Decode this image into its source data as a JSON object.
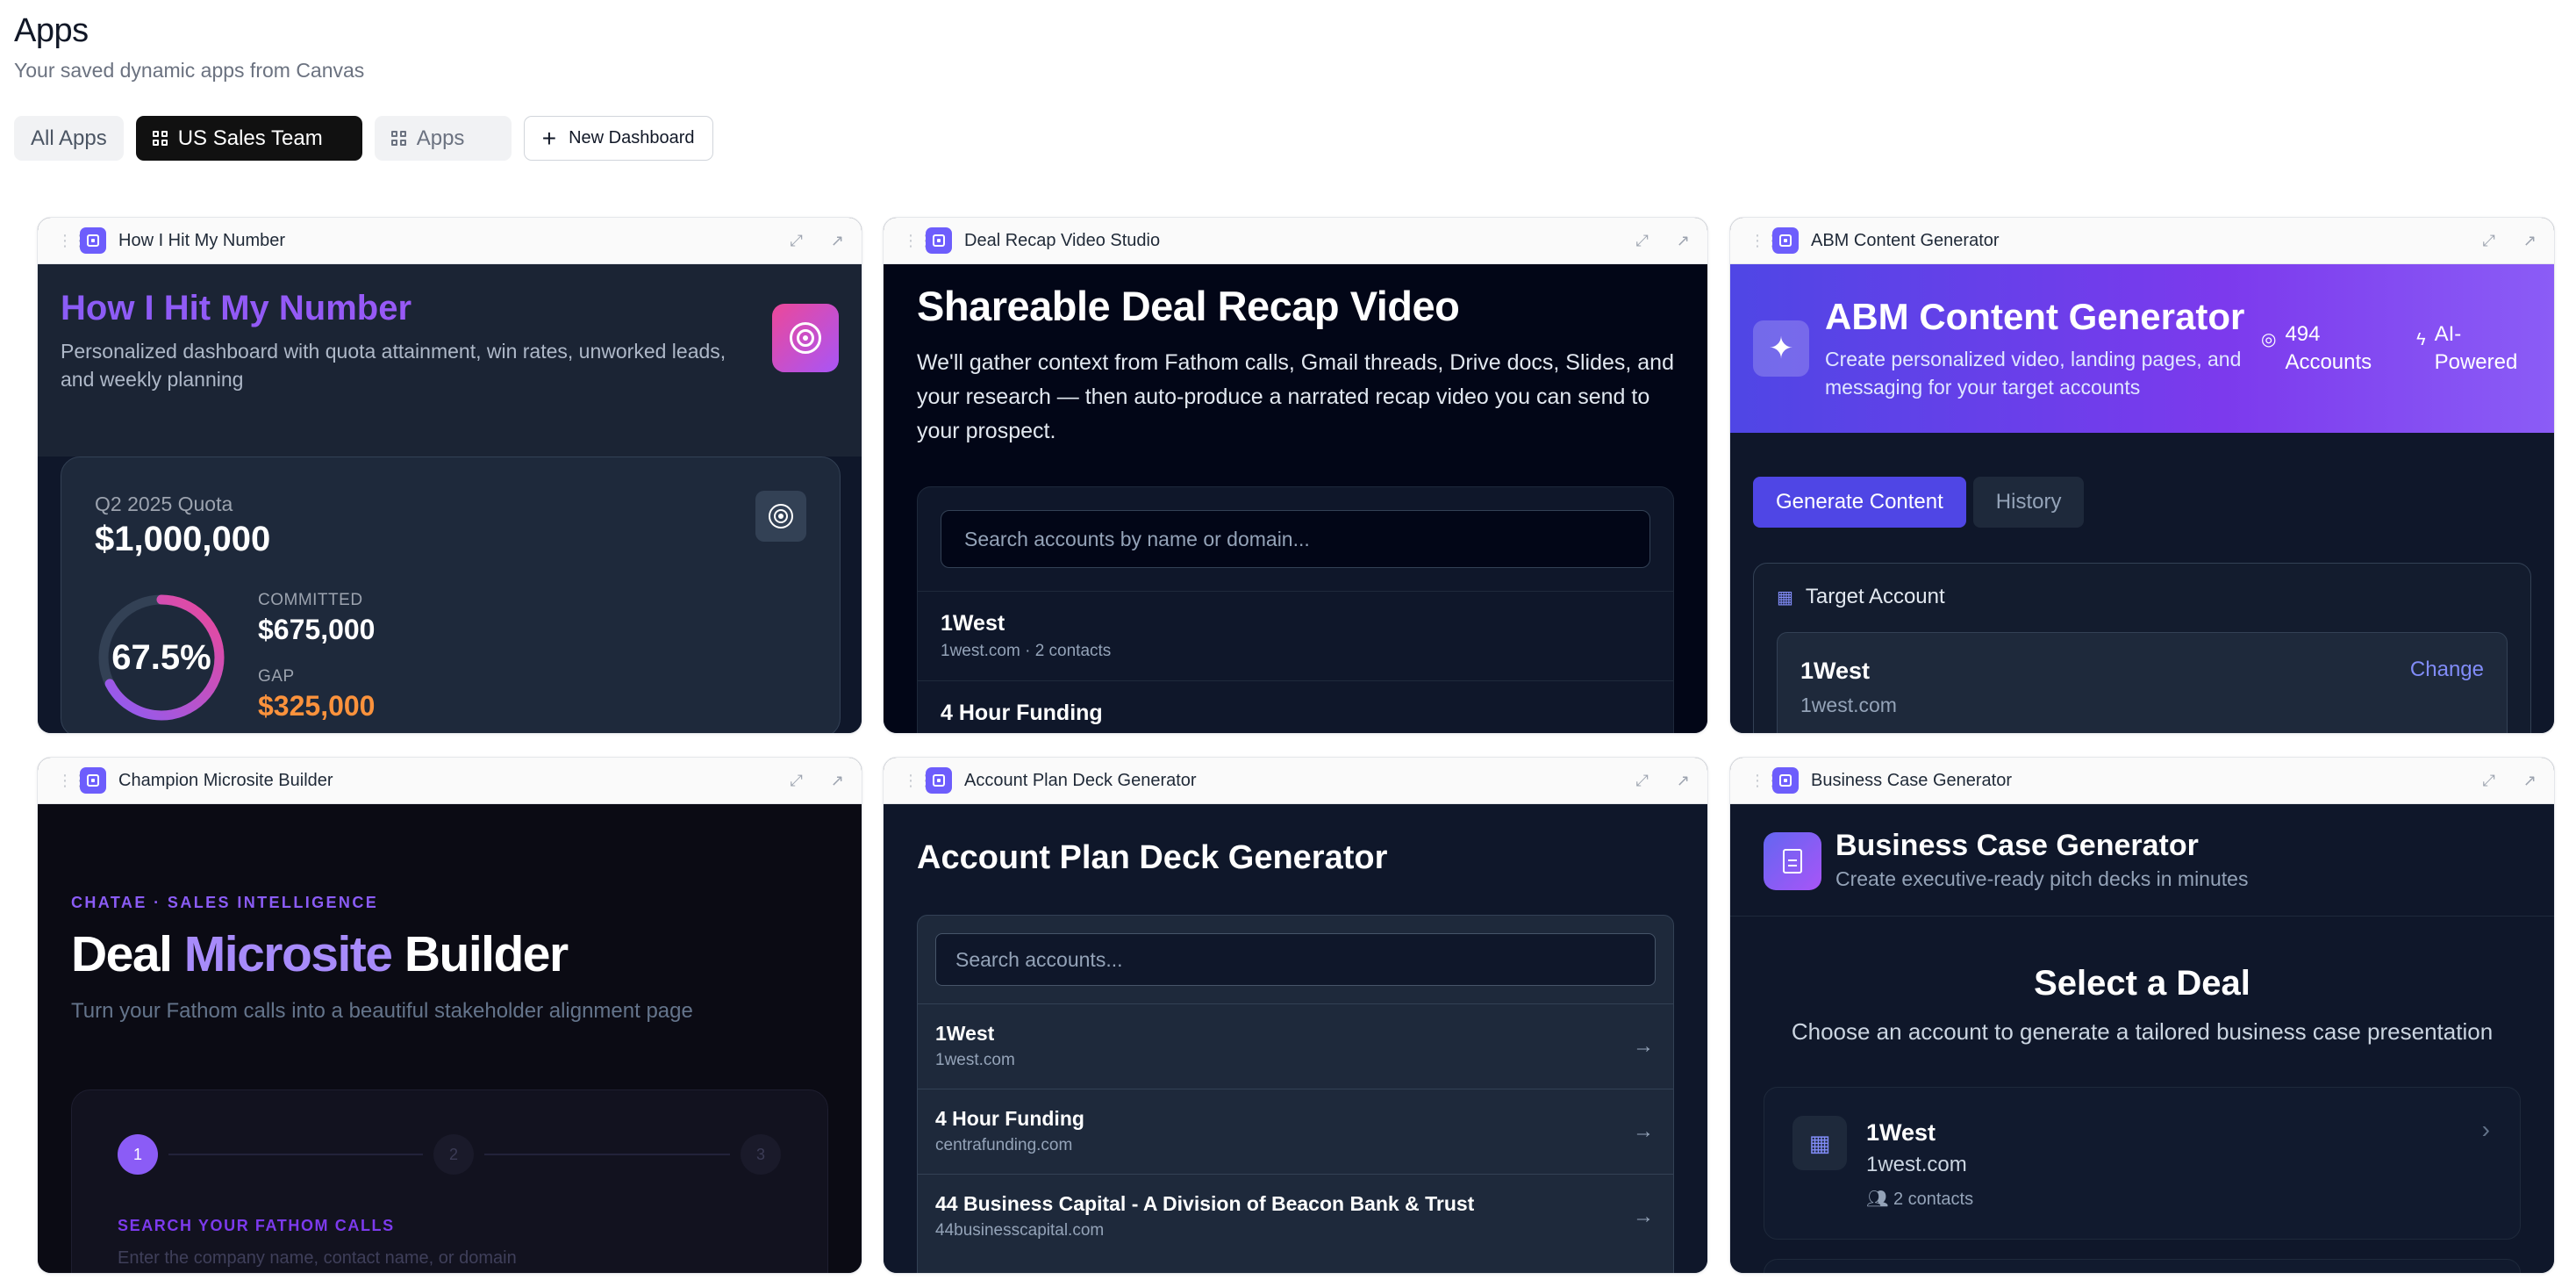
{
  "page": {
    "title": "Apps",
    "subtitle": "Your saved dynamic apps from Canvas"
  },
  "tabs": {
    "all": "All Apps",
    "sales": "US Sales Team",
    "apps": "Apps",
    "new": "New Dashboard"
  },
  "cards": {
    "hit": {
      "title": "How I Hit My Number",
      "heading": "How I Hit My Number",
      "description": "Personalized dashboard with quota attainment, win rates, unworked leads, and weekly planning",
      "quota_label": "Q2 2025 Quota",
      "quota_value": "$1,000,000",
      "percent_text": "67.5%",
      "percent": 0.675,
      "committed_label": "COMMITTED",
      "committed_value": "$675,000",
      "gap_label": "GAP",
      "gap_value": "$325,000"
    },
    "recap": {
      "title": "Deal Recap Video Studio",
      "heading": "Shareable Deal Recap Video",
      "description": "We'll gather context from Fathom calls, Gmail threads, Drive docs, Slides, and your research — then auto-produce a narrated recap video you can send to your prospect.",
      "search_placeholder": "Search accounts by name or domain...",
      "rows": [
        {
          "name": "1West",
          "detail": "1west.com · 2 contacts"
        },
        {
          "name": "4 Hour Funding",
          "detail": ""
        }
      ]
    },
    "abm": {
      "title": "ABM Content Generator",
      "heading": "ABM Content Generator",
      "description": "Create personalized video, landing pages, and messaging for your target accounts",
      "metric1": "494 Accounts",
      "metric2": "AI-Powered",
      "btn_generate": "Generate Content",
      "btn_history": "History",
      "target_label": "Target Account",
      "account_name": "1West",
      "account_domain": "1west.com",
      "change": "Change"
    },
    "champion": {
      "title": "Champion Microsite Builder",
      "kicker": "CHATAE · SALES INTELLIGENCE",
      "heading_a": "Deal ",
      "heading_b": "Microsite",
      "heading_c": " Builder",
      "subtitle": "Turn your Fathom calls into a beautiful stakeholder alignment page",
      "step1": "1",
      "step2": "2",
      "step3": "3",
      "search_label": "SEARCH YOUR FATHOM CALLS",
      "search_placeholder": "Enter the company name, contact name, or domain"
    },
    "deck": {
      "title": "Account Plan Deck Generator",
      "heading": "Account Plan Deck Generator",
      "search_placeholder": "Search accounts...",
      "rows": [
        {
          "name": "1West",
          "detail": "1west.com"
        },
        {
          "name": "4 Hour Funding",
          "detail": "centrafunding.com"
        },
        {
          "name": "44 Business Capital - A Division of Beacon Bank & Trust",
          "detail": "44businesscapital.com"
        }
      ]
    },
    "business": {
      "title": "Business Case Generator",
      "heading": "Business Case Generator",
      "subtitle": "Create executive-ready pitch decks in minutes",
      "select_title": "Select a Deal",
      "select_desc": "Choose an account to generate a tailored business case presentation",
      "deal_name": "1West",
      "deal_domain": "1west.com",
      "deal_contacts": "2 contacts"
    }
  },
  "colors": {
    "accent": "#6d5dfc",
    "gap": "#fb923c",
    "purple": "#8b5cf6"
  }
}
